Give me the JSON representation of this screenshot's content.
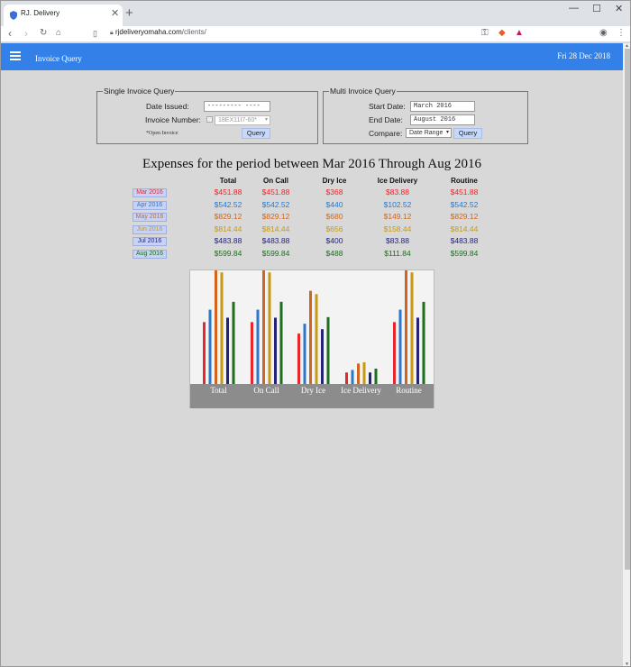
{
  "browser": {
    "tab_title": "RJ. Delivery",
    "url_host": "rjdeliveryomaha.com",
    "url_path": "/clients/"
  },
  "app": {
    "title": "Invoice Query",
    "date": "Fri 28 Dec 2018"
  },
  "single_query": {
    "legend": "Single Invoice Query",
    "date_issued_label": "Date Issued:",
    "date_issued_value": "--------- ----",
    "invoice_number_label": "Invoice Number:",
    "invoice_number_value": "18EX11I7-60*",
    "open_invoice_label": "*Open Invoice",
    "query_button": "Query"
  },
  "multi_query": {
    "legend": "Multi Invoice Query",
    "start_date_label": "Start Date:",
    "start_date_value": "March 2016",
    "end_date_label": "End Date:",
    "end_date_value": "August 2016",
    "compare_label": "Compare:",
    "compare_value": "Date Range",
    "query_button": "Query"
  },
  "summary": {
    "title": "Expenses for the period between Mar 2016 Through Aug 2016",
    "columns": [
      "Total",
      "On Call",
      "Dry Ice",
      "Ice Delivery",
      "Routine"
    ],
    "rows": [
      {
        "month": "Mar 2016",
        "color": "#e8262c",
        "values": [
          "$451.88",
          "$451.88",
          "$368",
          "$83.88",
          "$451.88"
        ]
      },
      {
        "month": "Apr 2016",
        "color": "#2b78c9",
        "values": [
          "$542.52",
          "$542.52",
          "$440",
          "$102.52",
          "$542.52"
        ]
      },
      {
        "month": "May 2016",
        "color": "#d2651e",
        "values": [
          "$829.12",
          "$829.12",
          "$680",
          "$149.12",
          "$829.12"
        ]
      },
      {
        "month": "Jun 2016",
        "color": "#c69a12",
        "values": [
          "$814.44",
          "$814.44",
          "$656",
          "$158.44",
          "$814.44"
        ]
      },
      {
        "month": "Jul 2016",
        "color": "#23237a",
        "values": [
          "$483.88",
          "$483.88",
          "$400",
          "$83.88",
          "$483.88"
        ]
      },
      {
        "month": "Aug 2016",
        "color": "#1d6e1d",
        "values": [
          "$599.84",
          "$599.84",
          "$488",
          "$111.84",
          "$599.84"
        ]
      }
    ]
  },
  "chart_data": {
    "type": "bar",
    "categories": [
      "Total",
      "On Call",
      "Dry Ice",
      "Ice Delivery",
      "Routine"
    ],
    "series": [
      {
        "name": "Mar 2016",
        "values": [
          451.88,
          451.88,
          368,
          83.88,
          451.88
        ]
      },
      {
        "name": "Apr 2016",
        "values": [
          542.52,
          542.52,
          440,
          102.52,
          542.52
        ]
      },
      {
        "name": "May 2016",
        "values": [
          829.12,
          829.12,
          680,
          149.12,
          829.12
        ]
      },
      {
        "name": "Jun 2016",
        "values": [
          814.44,
          814.44,
          656,
          158.44,
          814.44
        ]
      },
      {
        "name": "Jul 2016",
        "values": [
          483.88,
          483.88,
          400,
          83.88,
          483.88
        ]
      },
      {
        "name": "Aug 2016",
        "values": [
          599.84,
          599.84,
          488,
          111.84,
          599.84
        ]
      }
    ],
    "colors": [
      "#e8262c",
      "#2b78c9",
      "#d2651e",
      "#c69a12",
      "#23237a",
      "#1d6e1d"
    ],
    "ylim": [
      0,
      829.12
    ],
    "grid": false,
    "legend": "none"
  }
}
